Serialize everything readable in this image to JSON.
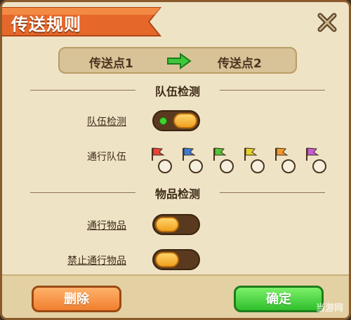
{
  "title": "传送规则",
  "route": {
    "from": "传送点1",
    "to": "传送点2"
  },
  "sections": {
    "team_check": "队伍检测",
    "item_check": "物品检测"
  },
  "rows": {
    "team_detect": {
      "label": "队伍检测",
      "enabled": true
    },
    "pass_team": {
      "label": "通行队伍"
    },
    "pass_items": {
      "label": "通行物品",
      "enabled": false
    },
    "ban_items": {
      "label": "禁止通行物品",
      "enabled": false
    }
  },
  "teams": [
    {
      "color": "#e8453c"
    },
    {
      "color": "#3a7ddc"
    },
    {
      "color": "#52c63a"
    },
    {
      "color": "#e6d32a"
    },
    {
      "color": "#f29a2e"
    },
    {
      "color": "#c75bd8"
    }
  ],
  "buttons": {
    "delete": "删除",
    "confirm": "确定"
  },
  "watermark": "当游网",
  "colors": {
    "accent_orange": "#f07f2e",
    "accent_green": "#2fbf2b",
    "panel_bg": "#efe3c6"
  }
}
